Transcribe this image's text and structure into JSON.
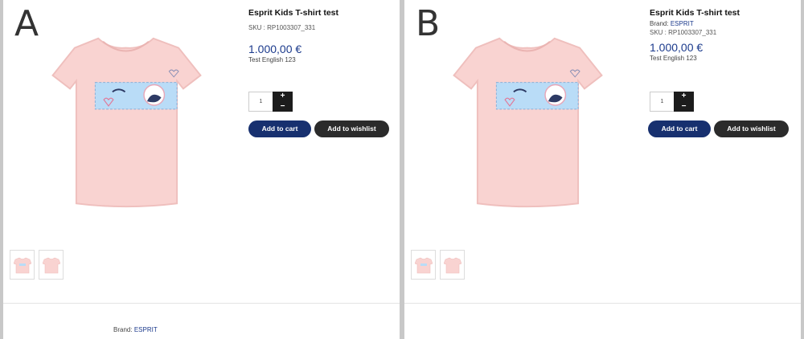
{
  "variant_a": {
    "label": "A",
    "product": {
      "title": "Esprit Kids T-shirt test",
      "sku": "SKU : RP1003307_331",
      "price": "1.000,00 €",
      "subtext": "Test English 123"
    },
    "quantity": {
      "value": "1",
      "plus": "+",
      "minus": "−"
    },
    "buttons": {
      "add_to_cart": "Add to cart",
      "add_to_wishlist": "Add to wishlist"
    },
    "bottom": {
      "brand_label": "Brand:",
      "brand_value": "ESPRIT"
    }
  },
  "variant_b": {
    "label": "B",
    "product": {
      "title": "Esprit Kids T-shirt test",
      "brand_label": "Brand:",
      "brand_value": "ESPRIT",
      "sku": "SKU : RP1003307_331",
      "price": "1.000,00 €",
      "subtext": "Test English 123"
    },
    "quantity": {
      "value": "1",
      "plus": "+",
      "minus": "−"
    },
    "buttons": {
      "add_to_cart": "Add to cart",
      "add_to_wishlist": "Add to wishlist"
    }
  },
  "colors": {
    "shirt": "#f9d3d1",
    "shirt_shadow": "#efbfbd",
    "patch": "#b9dcf7",
    "patch_border": "#8ab0d8",
    "accent": "#1b3a8c",
    "cart_button": "#17306f",
    "wishlist_button": "#2b2b2b"
  }
}
